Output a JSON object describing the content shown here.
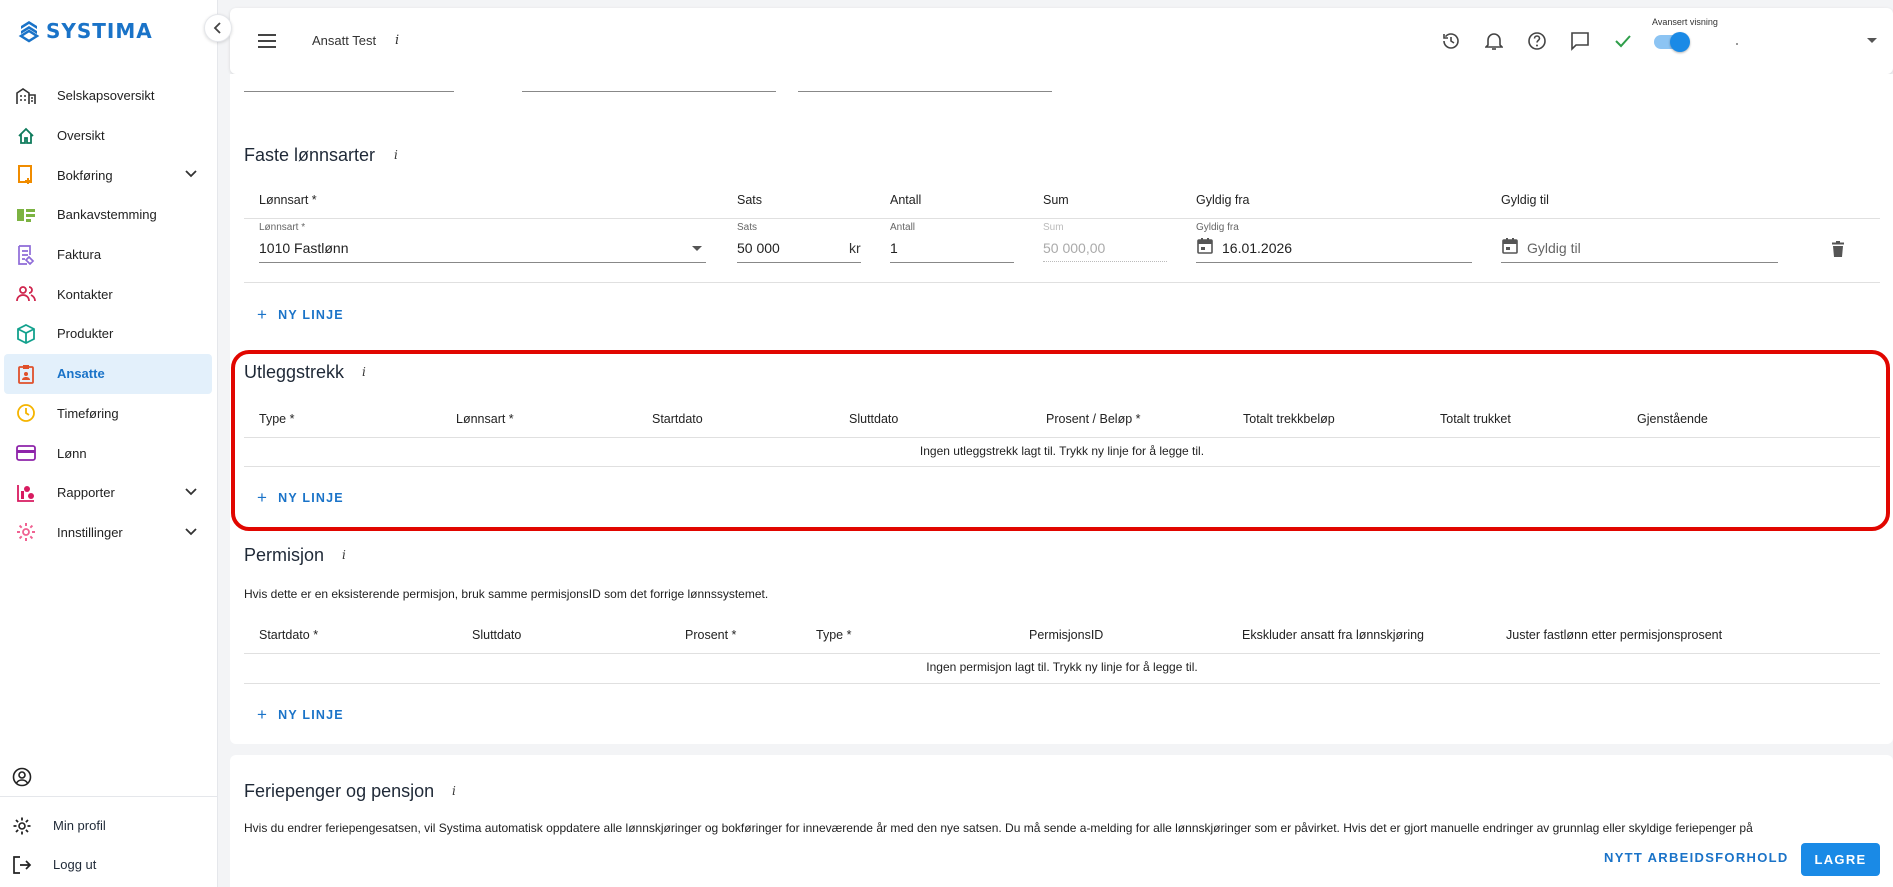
{
  "app": {
    "brand": "SYSTIMA",
    "accent_color": "#1a73c8",
    "highlight_color": "#e10600"
  },
  "sidebar": {
    "items": [
      {
        "label": "Selskapsoversikt",
        "icon": "building-icon"
      },
      {
        "label": "Oversikt",
        "icon": "home-icon"
      },
      {
        "label": "Bokføring",
        "icon": "ledger-icon",
        "expandable": true
      },
      {
        "label": "Bankavstemming",
        "icon": "bank-icon"
      },
      {
        "label": "Faktura",
        "icon": "invoice-icon"
      },
      {
        "label": "Kontakter",
        "icon": "contacts-icon"
      },
      {
        "label": "Produkter",
        "icon": "cube-icon"
      },
      {
        "label": "Ansatte",
        "icon": "employee-badge-icon",
        "active": true
      },
      {
        "label": "Timeføring",
        "icon": "clock-icon"
      },
      {
        "label": "Lønn",
        "icon": "payment-card-icon"
      },
      {
        "label": "Rapporter",
        "icon": "report-icon",
        "expandable": true
      },
      {
        "label": "Innstillinger",
        "icon": "gear-icon",
        "expandable": true
      }
    ],
    "bottom": [
      {
        "label": "",
        "icon": "account-circle-icon"
      },
      {
        "label": "Min profil",
        "icon": "settings-cog-icon"
      },
      {
        "label": "Logg ut",
        "icon": "logout-icon"
      }
    ]
  },
  "topbar": {
    "company": "Ansatt Test",
    "info": "i",
    "advanced_view_label": "Avansert visning",
    "advanced_view_on": true,
    "icons": [
      "history-icon",
      "bell-icon",
      "help-icon",
      "chat-icon",
      "check-icon"
    ]
  },
  "faste": {
    "title": "Faste lønnsarter",
    "info": "i",
    "headers": [
      "Lønnsart *",
      "Sats",
      "Antall",
      "Sum",
      "Gyldig fra",
      "Gyldig til"
    ],
    "row": {
      "lonnsart_label": "Lønnsart *",
      "lonnsart_value": "1010 Fastlønn",
      "sats_label": "Sats",
      "sats_value": "50 000",
      "sats_unit": "kr",
      "antall_label": "Antall",
      "antall_value": "1",
      "sum_label": "Sum",
      "sum_value": "50 000,00",
      "fra_label": "Gyldig fra",
      "fra_value": "16.01.2026",
      "til_placeholder": "Gyldig til"
    },
    "new_line": "NY LINJE"
  },
  "utlegg": {
    "title": "Utleggstrekk",
    "info": "i",
    "headers": [
      "Type *",
      "Lønnsart *",
      "Startdato",
      "Sluttdato",
      "Prosent / Beløp *",
      "Totalt trekkbeløp",
      "Totalt trukket",
      "Gjenstående"
    ],
    "empty": "Ingen utleggstrekk lagt til. Trykk ny linje for å legge til.",
    "new_line": "NY LINJE"
  },
  "permisjon": {
    "title": "Permisjon",
    "info": "i",
    "description": "Hvis dette er en eksisterende permisjon, bruk samme permisjonsID som det forrige lønnssystemet.",
    "headers": [
      "Startdato *",
      "Sluttdato",
      "Prosent *",
      "Type *",
      "PermisjonsID",
      "Ekskluder ansatt fra lønnskjøring",
      "Juster fastlønn etter permisjonsprosent"
    ],
    "empty": "Ingen permisjon lagt til. Trykk ny linje for å legge til.",
    "new_line": "NY LINJE"
  },
  "feriepenger": {
    "title": "Feriepenger og pensjon",
    "info": "i",
    "description": "Hvis du endrer feriepengesatsen, vil Systima automatisk oppdatere alle lønnskjøringer og bokføringer for inneværende år med den nye satsen. Du må sende a-melding for alle lønnskjøringer som er påvirket. Hvis det er gjort manuelle endringer av grunnlag eller skyldige feriepenger på"
  },
  "footer": {
    "secondary": "NYTT ARBEIDSFORHOLD",
    "primary": "LAGRE"
  }
}
